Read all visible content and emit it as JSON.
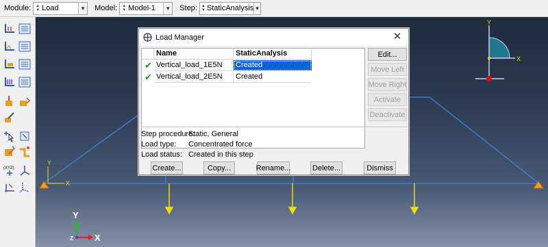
{
  "topbar": {
    "module_label": "Module:",
    "module_value": "Load",
    "model_label": "Model:",
    "model_value": "Model-1",
    "step_label": "Step:",
    "step_value": "StaticAnalysis"
  },
  "dialog": {
    "title": "Load Manager",
    "columns": [
      "Name",
      "StaticAnalysis"
    ],
    "rows": [
      {
        "name": "Vertical_load_1E5N",
        "status": "Created",
        "checked": true
      },
      {
        "name": "Vertical_load_2E5N",
        "status": "Created",
        "checked": true
      }
    ],
    "side_buttons": [
      "Edit...",
      "Move Left",
      "Move Right",
      "Activate",
      "Deactivate"
    ],
    "info": [
      {
        "key": "Step procedure:",
        "value": "Static, General"
      },
      {
        "key": "Load type:",
        "value": "Concentrated force"
      },
      {
        "key": "Load status:",
        "value": "Created in this step"
      }
    ],
    "buttons": [
      "Create...",
      "Copy...",
      "Rename...",
      "Delete...",
      "Dismiss"
    ]
  },
  "viewport": {
    "model_axis_y": "Y",
    "model_axis_x": "X",
    "triad_y": "Y",
    "triad_x": "X",
    "global_axis_y": "Y",
    "global_axis_x": "X",
    "global_axis_z": "Z"
  },
  "colors": {
    "selection": "#0a64d2",
    "load_arrow": "#e8e000",
    "truss": "#3a7bd5"
  }
}
